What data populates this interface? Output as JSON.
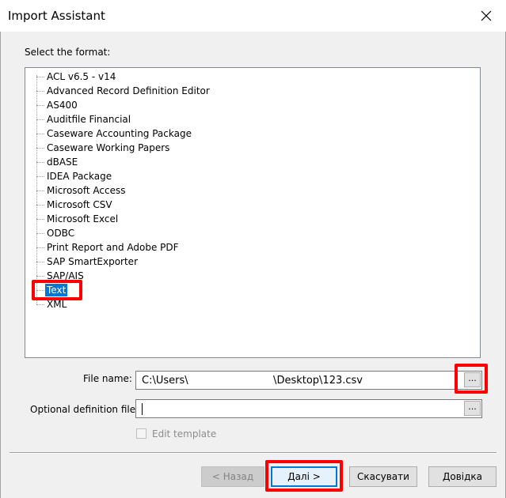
{
  "window": {
    "title": "Import Assistant",
    "close_glyph": "✕"
  },
  "select_format_label": "Select the format:",
  "formats": [
    "ACL v6.5 - v14",
    "Advanced Record Definition Editor",
    "AS400",
    "Auditfile Financial",
    "Caseware Accounting Package",
    "Caseware Working Papers",
    "dBASE",
    "IDEA Package",
    "Microsoft Access",
    "Microsoft CSV",
    "Microsoft Excel",
    "ODBC",
    "Print Report and Adobe PDF",
    "SAP SmartExporter",
    "SAP/AIS",
    "Text",
    "XML"
  ],
  "selected_format": "Text",
  "file_name": {
    "label": "File name:",
    "value": "C:\\Users\\                          \\Desktop\\123.csv",
    "browse_label": "..."
  },
  "optional_definition": {
    "label": "Optional definition file:",
    "value": "",
    "browse_label": "..."
  },
  "edit_template": {
    "label": "Edit template",
    "checked": false,
    "enabled": false
  },
  "buttons": {
    "back": "< Назад",
    "next": "Далі >",
    "cancel": "Скасувати",
    "help": "Довідка"
  },
  "colors": {
    "highlight": "#ff0000",
    "selection": "#0078d7",
    "default_button_border": "#0078d7"
  }
}
